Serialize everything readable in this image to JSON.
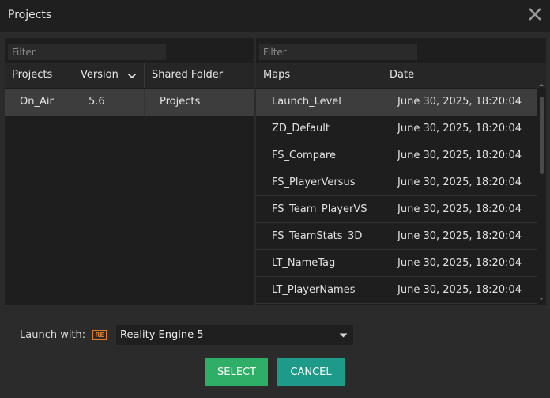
{
  "window": {
    "title": "Projects"
  },
  "left": {
    "filter_placeholder": "Filter",
    "columns": {
      "projects": "Projects",
      "version": "Version",
      "shared_folder": "Shared Folder"
    },
    "rows": [
      {
        "project": "On_Air",
        "version": "5.6",
        "shared_folder": "Projects"
      }
    ]
  },
  "right": {
    "filter_placeholder": "Filter",
    "columns": {
      "maps": "Maps",
      "date": "Date"
    },
    "rows": [
      {
        "map": "Launch_Level",
        "date": "June 30, 2025, 18:20:04"
      },
      {
        "map": "ZD_Default",
        "date": "June 30, 2025, 18:20:04"
      },
      {
        "map": "FS_Compare",
        "date": "June 30, 2025, 18:20:04"
      },
      {
        "map": "FS_PlayerVersus",
        "date": "June 30, 2025, 18:20:04"
      },
      {
        "map": "FS_Team_PlayerVS",
        "date": "June 30, 2025, 18:20:04"
      },
      {
        "map": "FS_TeamStats_3D",
        "date": "June 30, 2025, 18:20:04"
      },
      {
        "map": "LT_NameTag",
        "date": "June 30, 2025, 18:20:04"
      },
      {
        "map": "LT_PlayerNames",
        "date": "June 30, 2025, 18:20:04"
      }
    ]
  },
  "launch": {
    "label": "Launch with:",
    "badge": "RE",
    "engine": "Reality Engine 5"
  },
  "buttons": {
    "select": "SELECT",
    "cancel": "CANCEL"
  },
  "colors": {
    "select_button": "#2fae67",
    "cancel_button": "#1d9a8a",
    "badge": "#e07b2a",
    "selected_row": "#3d3d3d"
  }
}
